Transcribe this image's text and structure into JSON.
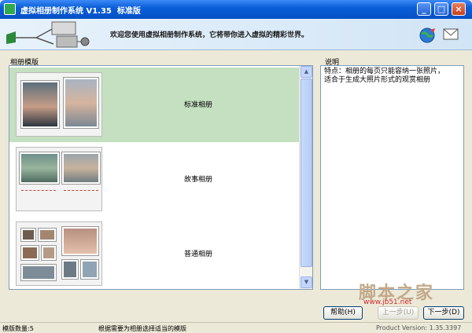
{
  "window": {
    "title": "虚拟相册制作系统 V1.35  标准版",
    "buttons": {
      "minimize": "_",
      "maximize": "□",
      "close": "×"
    }
  },
  "banner": {
    "welcome": "欢迎您使用虚拟相册制作系统，它将带你进入虚拟的精彩世界。",
    "icons": [
      "network-diagram-icon",
      "globe-icon",
      "mail-icon"
    ]
  },
  "templates": {
    "label": "相册模版",
    "items": [
      {
        "name": "标准相册",
        "selected": true
      },
      {
        "name": "故事相册",
        "selected": false
      },
      {
        "name": "普通相册",
        "selected": false
      }
    ]
  },
  "description": {
    "label": "说明",
    "lines": [
      "特点：相册的每页只能容纳一张照片，",
      "适合于生成大照片形式的观赏相册"
    ]
  },
  "buttons": {
    "help": "帮助(H)",
    "prev": "上一步(U)",
    "next": "下一步(D)"
  },
  "status": {
    "count": "模版数量:5",
    "hint": "根据需要为相册选择适当的模版",
    "version": "Product Version:  1.35.3397"
  },
  "watermark": {
    "text": "脚本之家",
    "url": "www.jb51.net"
  },
  "colors": {
    "title_bar": "#0a5fd8",
    "selected_row": "#c4e0c0",
    "watermark": "#c2a98a"
  }
}
